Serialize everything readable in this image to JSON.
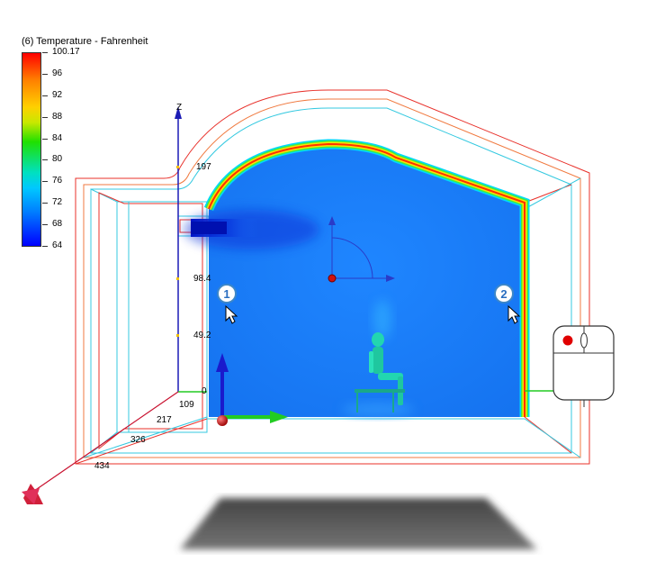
{
  "legend": {
    "title": "(6) Temperature - Fahrenheit",
    "labels": [
      "100.17",
      "96",
      "92",
      "88",
      "84",
      "80",
      "76",
      "72",
      "68",
      "64"
    ]
  },
  "axes": {
    "z_label": "Z",
    "z_ticks": [
      "197",
      "98.4",
      "49.2",
      "0"
    ],
    "x_ticks": [
      "109",
      "217",
      "326",
      "434"
    ]
  },
  "markers": {
    "point1": "1",
    "point2": "2"
  },
  "colors": {
    "room_fill": "#1a7dff",
    "hot_edge": "#ff3000",
    "wire_red": "#e8302a",
    "wire_cyan": "#34c9e0",
    "axis_blue": "#1b1bb5",
    "axis_green": "#22cc22",
    "axis_red": "#c8102e",
    "figure": "#22d6b0"
  }
}
